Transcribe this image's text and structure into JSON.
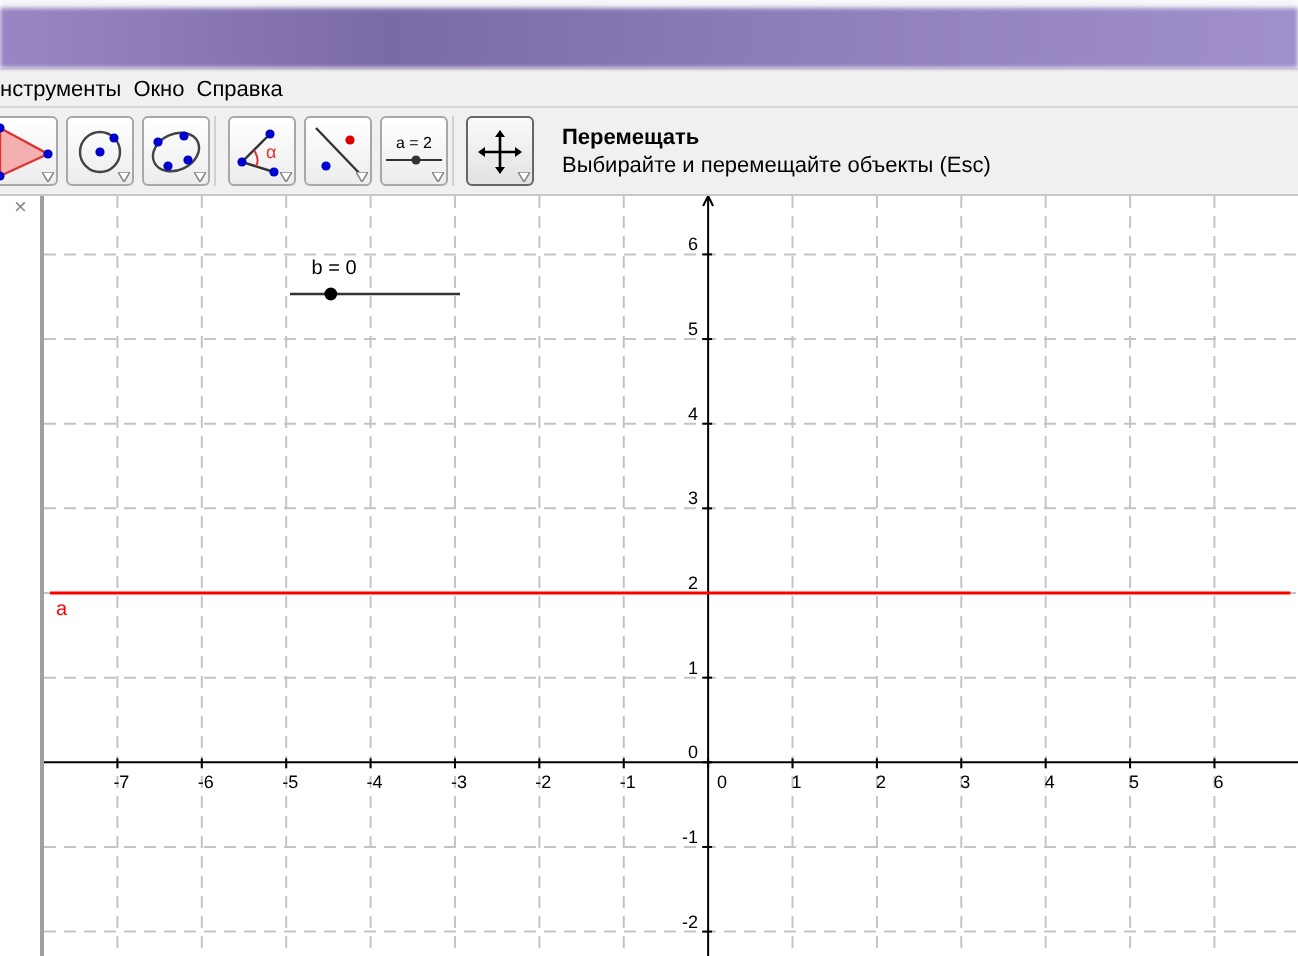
{
  "menu": [
    {
      "label": "нструменты"
    },
    {
      "label": "Окно"
    },
    {
      "label": "Справка"
    }
  ],
  "toolbar": {
    "tools": [
      {
        "kind": "polygon",
        "selected": false
      },
      {
        "kind": "circle",
        "selected": false
      },
      {
        "kind": "conic",
        "selected": false
      },
      {
        "kind": "angle",
        "label": "α",
        "selected": false
      },
      {
        "kind": "reflect",
        "selected": false
      },
      {
        "kind": "slider",
        "label": "a = 2",
        "selected": false
      },
      {
        "kind": "move",
        "selected": true
      }
    ],
    "tool_name": "Перемещать",
    "tool_help": "Выбирайте и перемещайте объекты (Esc)"
  },
  "graphics": {
    "close": "×",
    "slider": {
      "label": "b = 0",
      "level": 0.24
    },
    "chart_data": {
      "type": "line",
      "grid": true,
      "x": [
        -7.8,
        6.9
      ],
      "series": [
        {
          "name": "a",
          "color": "#ff0000",
          "values": [
            2,
            2
          ]
        }
      ],
      "xlim": [
        -7.87,
        6.99
      ],
      "ylim": [
        -2.43,
        6.69
      ],
      "xticks": [
        -7,
        -6,
        -5,
        -4,
        -3,
        -2,
        -1,
        0,
        1,
        2,
        3,
        4,
        5,
        6
      ],
      "yticks": [
        -2,
        -1,
        0,
        1,
        2,
        3,
        4,
        5,
        6
      ]
    }
  }
}
